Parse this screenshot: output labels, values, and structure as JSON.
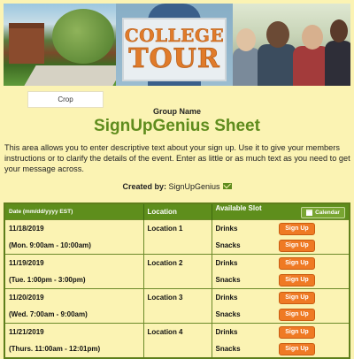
{
  "banner": {
    "sign_line1": "COLLEGE",
    "sign_line2": "TOUR"
  },
  "crop_label": "Crop",
  "group_name": "Group Name",
  "sheet_title": "SignUpGenius Sheet",
  "description": "This area allows you to enter descriptive text about your sign up. Use it to give your members instructions or to clarify the details of the event. Enter as little or as much text as you need to get your message across.",
  "created_by": {
    "label": "Created by:",
    "name": "SignUpGenius",
    "icon": "mail-icon"
  },
  "table": {
    "headers": {
      "date": "Date (mm/dd/yyyy EST)",
      "location": "Location",
      "slot": "Available Slot",
      "calendar": "Calendar"
    },
    "rows": [
      {
        "date": "11/18/2019",
        "time": "(Mon. 9:00am - 10:00am)",
        "location": "Location 1",
        "slots": [
          "Drinks",
          "Snacks"
        ],
        "button": "Sign Up"
      },
      {
        "date": "11/19/2019",
        "time": "(Tue. 1:00pm - 3:00pm)",
        "location": "Location 2",
        "slots": [
          "Drinks",
          "Snacks"
        ],
        "button": "Sign Up"
      },
      {
        "date": "11/20/2019",
        "time": "(Wed. 7:00am - 9:00am)",
        "location": "Location 3",
        "slots": [
          "Drinks",
          "Snacks"
        ],
        "button": "Sign Up"
      },
      {
        "date": "11/21/2019",
        "time": "(Thurs. 11:00am - 12:01pm)",
        "location": "Location 4",
        "slots": [
          "Drinks",
          "Snacks"
        ],
        "button": "Sign Up"
      }
    ]
  },
  "colors": {
    "background": "#fbf3b3",
    "accent_green": "#5e8e1c",
    "title_green": "#5f8c1d",
    "button_orange": "#ef7a24"
  }
}
